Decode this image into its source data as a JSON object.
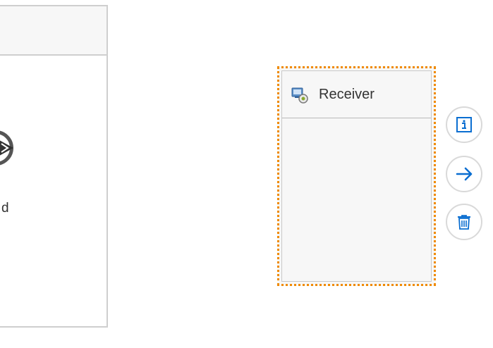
{
  "diagram": {
    "end_event": {
      "label": "d"
    },
    "receiver": {
      "title": "Receiver",
      "icon": "receiver-system-icon"
    },
    "context_actions": [
      {
        "icon": "info-icon"
      },
      {
        "icon": "arrow-right-icon"
      },
      {
        "icon": "trash-icon"
      }
    ]
  },
  "colors": {
    "selection": "#f08a00",
    "action_blue": "#0a6ed1",
    "border_gray": "#cfcfcf"
  }
}
